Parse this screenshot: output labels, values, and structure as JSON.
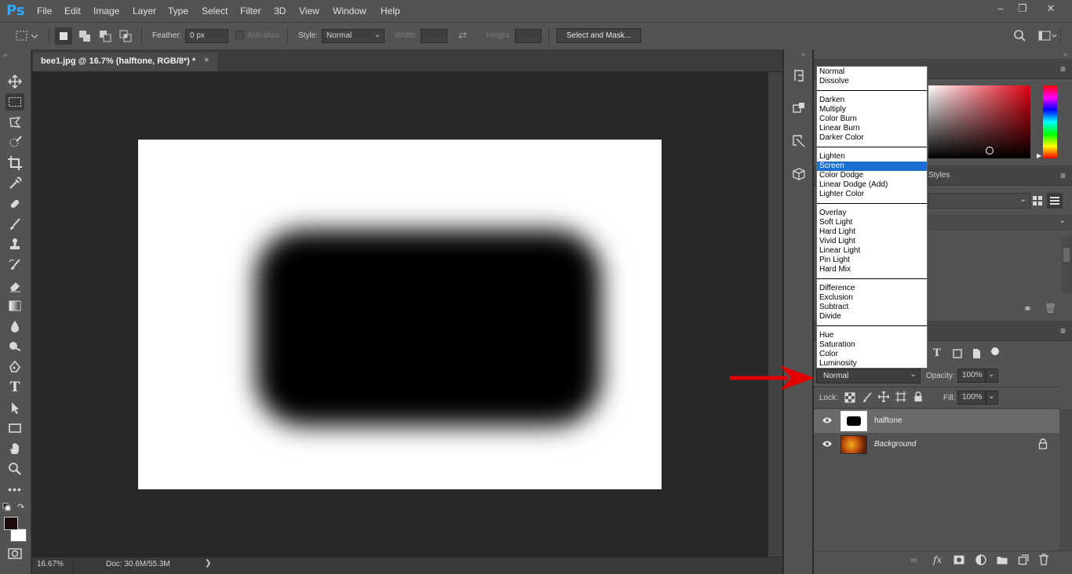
{
  "app": {
    "logo": "Ps"
  },
  "menubar": [
    "File",
    "Edit",
    "Image",
    "Layer",
    "Type",
    "Select",
    "Filter",
    "3D",
    "View",
    "Window",
    "Help"
  ],
  "options": {
    "feather_label": "Feather:",
    "feather_value": "0 px",
    "antialias_label": "Anti-alias",
    "style_label": "Style:",
    "style_value": "Normal",
    "width_label": "Width:",
    "height_label": "Height:",
    "select_mask_button": "Select and Mask..."
  },
  "document": {
    "tab_title": "bee1.jpg @ 16.7% (halftone, RGB/8*) *",
    "close": "×"
  },
  "status": {
    "zoom": "16.67%",
    "doc_info": "Doc: 30.6M/55.3M",
    "arrow": "❯"
  },
  "blend_menu": {
    "groups": [
      [
        "Normal",
        "Dissolve"
      ],
      [
        "Darken",
        "Multiply",
        "Color Burn",
        "Linear Burn",
        "Darker Color"
      ],
      [
        "Lighten",
        "Screen",
        "Color Dodge",
        "Linear Dodge (Add)",
        "Lighter Color"
      ],
      [
        "Overlay",
        "Soft Light",
        "Hard Light",
        "Vivid Light",
        "Linear Light",
        "Pin Light",
        "Hard Mix"
      ],
      [
        "Difference",
        "Exclusion",
        "Subtract",
        "Divide"
      ],
      [
        "Hue",
        "Saturation",
        "Color",
        "Luminosity"
      ]
    ],
    "highlighted": "Screen"
  },
  "panels": {
    "styles_tab": "Styles"
  },
  "layers": {
    "blend_mode": "Normal",
    "opacity_label": "Opacity:",
    "opacity_value": "100%",
    "lock_label": "Lock:",
    "fill_label": "Fill:",
    "fill_value": "100%",
    "items": [
      {
        "name": "halftone",
        "italic": false
      },
      {
        "name": "Background",
        "italic": true
      }
    ]
  },
  "colors": {
    "accent_blue": "#1c6fd1",
    "annotation_arrow": "#e00000",
    "ps_logo": "#31a8ff"
  },
  "icons": [
    "move-icon",
    "marquee-icon",
    "lasso-icon",
    "quick-select-icon",
    "crop-icon",
    "eyedropper-icon",
    "healing-icon",
    "brush-icon",
    "stamp-icon",
    "history-brush-icon",
    "eraser-icon",
    "gradient-icon",
    "blur-icon",
    "dodge-icon",
    "pen-icon",
    "type-icon",
    "path-select-icon",
    "rectangle-icon",
    "hand-icon",
    "zoom-icon",
    "more-icon"
  ]
}
